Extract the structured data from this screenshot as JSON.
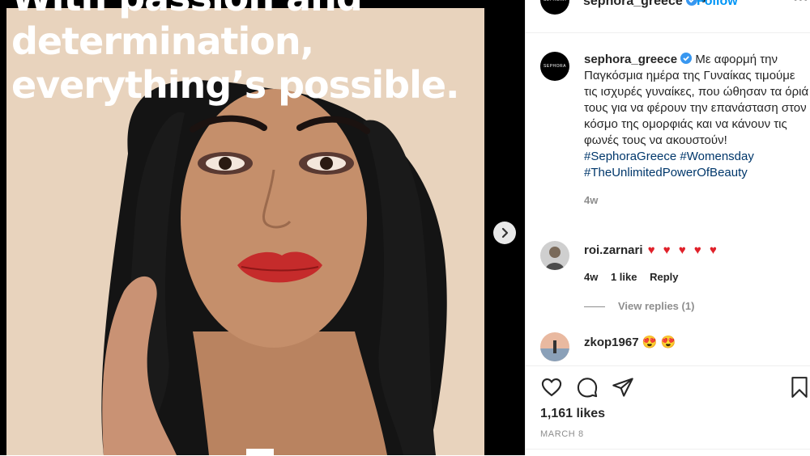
{
  "post": {
    "headline_lines": [
      "With passion and",
      "determination,",
      "everything’s possible."
    ]
  },
  "header": {
    "username": "sephora_greece",
    "separator": "•",
    "follow_label": "Follow",
    "avatar_text": "SEPHORA",
    "more_icon": "more-icon"
  },
  "caption": {
    "username": "sephora_greece",
    "text": "Με αφορμή την Παγκόσμια ημέρα της Γυναίκας τιμούμε τις ισχυρές γυναίκες, που ώθησαν τα όριά τους για να φέρουν την επανάσταση στον κόσμο της ομορφιάς και να κάνουν τις φωνές τους να ακουστούν!",
    "hashtags": [
      "#SephoraGreece",
      "#Womensday",
      "#TheUnlimitedPowerOfBeauty"
    ],
    "time": "4w"
  },
  "comments": [
    {
      "username": "roi.zarnari",
      "text": "♥ ♥ ♥ ♥ ♥",
      "time": "4w",
      "likes": "1 like",
      "reply_label": "Reply",
      "view_replies": "View replies (1)"
    },
    {
      "username": "zkop1967",
      "text": "😍 😍"
    }
  ],
  "actions": {
    "likes": "1,161 likes",
    "date": "MARCH 8"
  },
  "colors": {
    "link": "#00376b",
    "follow": "#0095f6",
    "muted": "#8e8e8e"
  }
}
